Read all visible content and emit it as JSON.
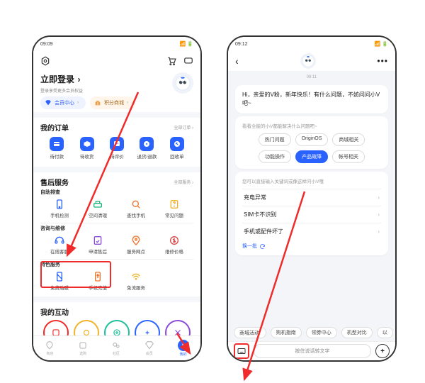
{
  "left": {
    "status": {
      "time": "09:09",
      "icons": "📶 🔋"
    },
    "header": {
      "title": ""
    },
    "login": {
      "title": "立即登录",
      "arrow": "›",
      "sub": "登录享受更多会员权益"
    },
    "pills": {
      "member": {
        "label": "会员中心",
        "chev": "›"
      },
      "points": {
        "label": "积分商城",
        "chev": "›"
      }
    },
    "orders": {
      "title": "我的订单",
      "more": "全部订单 ›",
      "items": [
        {
          "label": "待付款"
        },
        {
          "label": "待收货"
        },
        {
          "label": "待评价"
        },
        {
          "label": "退货/退款"
        },
        {
          "label": "回收单"
        }
      ]
    },
    "after": {
      "title": "售后服务",
      "more": "全部服务 ›",
      "g1_title": "自助排查",
      "g1": [
        {
          "label": "手机检测"
        },
        {
          "label": "空间清理"
        },
        {
          "label": "查找手机"
        },
        {
          "label": "常见问题"
        }
      ],
      "g2_title": "咨询与维修",
      "g2": [
        {
          "label": "在线客服"
        },
        {
          "label": "申请售后"
        },
        {
          "label": "服务网点"
        },
        {
          "label": "维修价格"
        }
      ],
      "g3_title": "特色服务",
      "g3": [
        {
          "label": "免费贴膜"
        },
        {
          "label": "手机充值"
        },
        {
          "label": "免流服务"
        }
      ]
    },
    "inter": {
      "title": "我的互动"
    },
    "nav": [
      {
        "label": "商店"
      },
      {
        "label": "选购"
      },
      {
        "label": "社区"
      },
      {
        "label": "会员"
      },
      {
        "label": "我的"
      }
    ]
  },
  "right": {
    "status": {
      "time": "09:12",
      "icons": "📶 🔋"
    },
    "time_bubble": "09:11",
    "greet": "Hi，亲爱的V粉，新年快乐！有什么问题，不妨问问小V吧~",
    "hint": "看看全能的小V都能解决什么问题吧~",
    "chips": [
      {
        "label": "热门问题"
      },
      {
        "label": "OriginOS"
      },
      {
        "label": "商城相关"
      },
      {
        "label": "功能操作"
      },
      {
        "label": "产品故障"
      },
      {
        "label": "帐号相关"
      }
    ],
    "list_hint": "您可以直接输入关键词或像这样问小V哦",
    "list": [
      {
        "label": "充电异常"
      },
      {
        "label": "SIM卡不识别"
      },
      {
        "label": "手机或配件坏了"
      }
    ],
    "refresh": "换一批",
    "bottom_chips": [
      {
        "label": "商城活动"
      },
      {
        "label": "购机指南"
      },
      {
        "label": "领券中心"
      },
      {
        "label": "机型对比"
      },
      {
        "label": "以"
      }
    ],
    "hold": "按住说话转文字"
  }
}
